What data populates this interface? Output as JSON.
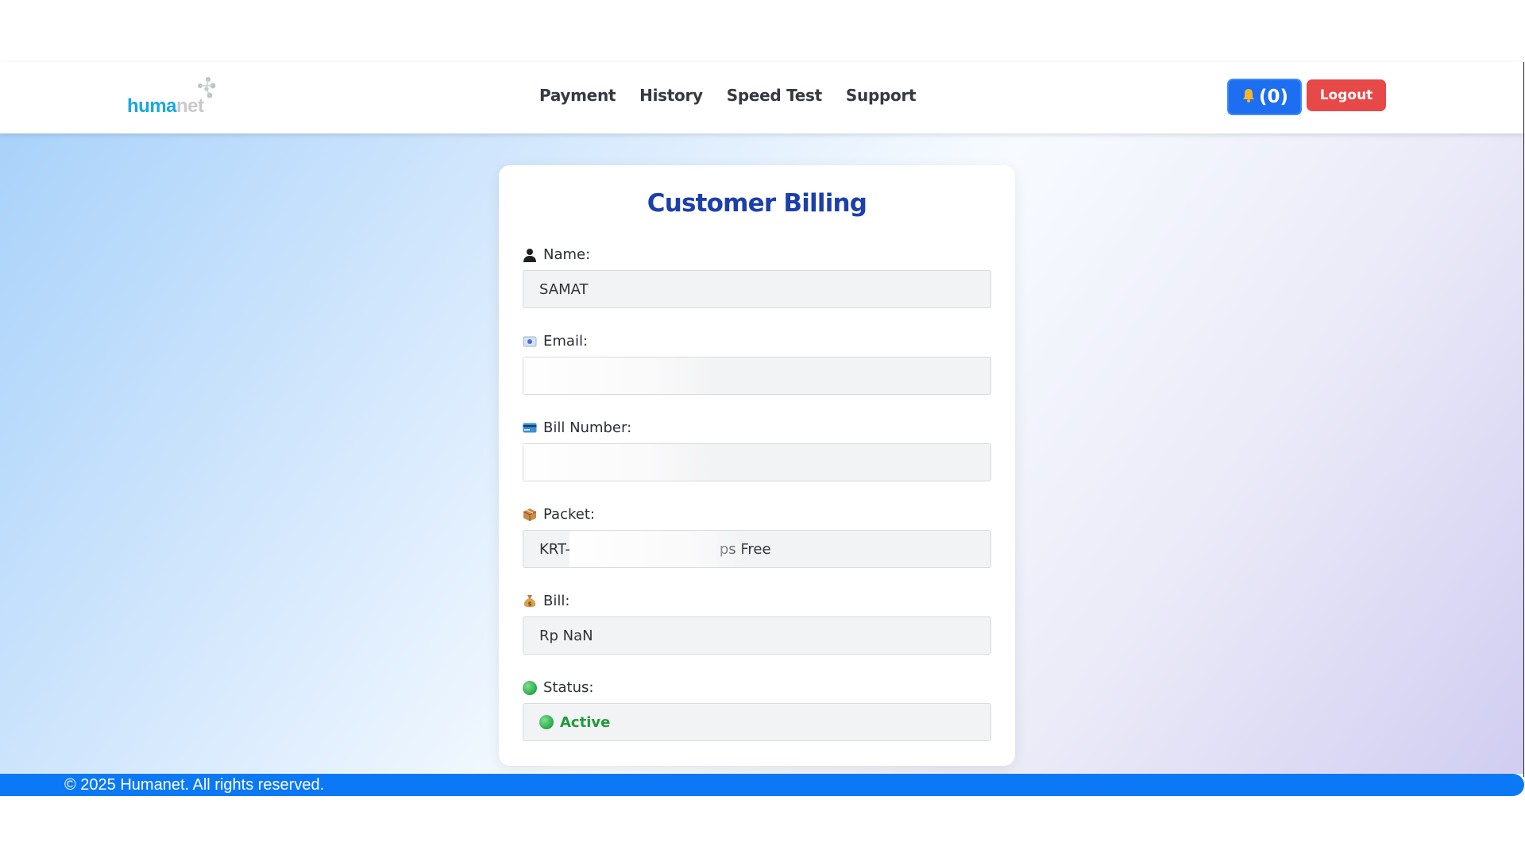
{
  "brand": {
    "logo_part1": "huma",
    "logo_part2": "net"
  },
  "nav": {
    "items": [
      {
        "label": "Payment"
      },
      {
        "label": "History"
      },
      {
        "label": "Speed Test"
      },
      {
        "label": "Support"
      }
    ]
  },
  "header_actions": {
    "notification_count": "(0)",
    "notification_icon": "bell-icon",
    "logout_label": "Logout"
  },
  "card": {
    "title": "Customer Billing",
    "fields": {
      "name": {
        "label": "Name:",
        "icon": "user-icon",
        "value": "SAMAT"
      },
      "email": {
        "label": "Email:",
        "icon": "email-icon",
        "value": ""
      },
      "bill_number": {
        "label": "Bill Number:",
        "icon": "card-icon",
        "value": ""
      },
      "packet": {
        "label": "Packet:",
        "icon": "package-icon",
        "value_prefix": "KRT-",
        "value_suffix": "ps Free"
      },
      "bill": {
        "label": "Bill:",
        "icon": "money-bag-icon",
        "value": "Rp NaN"
      },
      "status": {
        "label": "Status:",
        "icon": "green-circle-icon",
        "value": "Active"
      }
    }
  },
  "footer": {
    "text": "© 2025 Humanet. All rights reserved."
  },
  "colors": {
    "primary": "#1d6ef0",
    "logout": "#e74848",
    "title": "#1c3faa",
    "status_active": "#1f9a3a",
    "footer_bg": "#0b79f5"
  }
}
